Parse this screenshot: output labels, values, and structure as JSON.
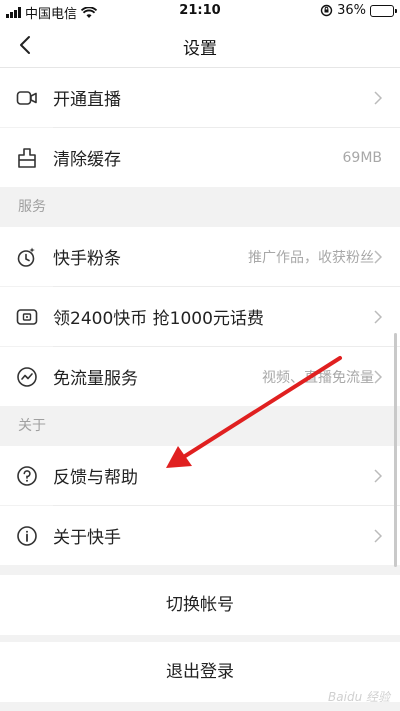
{
  "status_bar": {
    "carrier": "中国电信",
    "time": "21:10",
    "battery": "36%",
    "battery_level": 0.36
  },
  "nav": {
    "title": "设置",
    "back_icon": "chevron-left-icon"
  },
  "rows_top": [
    {
      "label": "开通直播",
      "icon": "camera-icon",
      "value": ""
    },
    {
      "label": "清除缓存",
      "icon": "broom-icon",
      "value": "69MB"
    }
  ],
  "section_service": {
    "header": "服务",
    "items": [
      {
        "label": "快手粉条",
        "icon": "boost-icon",
        "value": "推广作品，收获粉丝"
      },
      {
        "label": "领2400快币 抢1000元话费",
        "icon": "coupon-icon",
        "value": ""
      },
      {
        "label": "免流量服务",
        "icon": "data-icon",
        "value": "视频、直播免流量"
      }
    ]
  },
  "section_about": {
    "header": "关于",
    "items": [
      {
        "label": "反馈与帮助",
        "icon": "question-icon",
        "value": ""
      },
      {
        "label": "关于快手",
        "icon": "info-icon",
        "value": ""
      }
    ]
  },
  "actions": {
    "switch_account": "切换帐号",
    "logout": "退出登录"
  },
  "annotation": {
    "arrow_color": "#e02020"
  },
  "watermark": "Baidu 经验"
}
